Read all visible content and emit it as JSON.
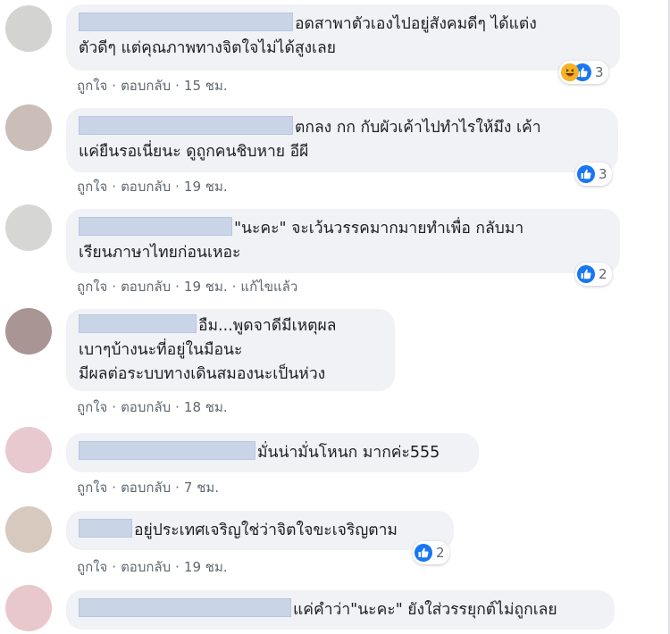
{
  "comments": [
    {
      "lines": [
        "อดสาพาตัวเองไปอยู่สังคมดีๆ ได้แต่ง",
        "ตัวดีๆ แต่คุณภาพทางจิตใจไม่ได้สูงเลย"
      ],
      "actions": {
        "like": "ถูกใจ",
        "reply": "ตอบกลับ",
        "time": "15 ชม."
      },
      "reactions": {
        "icons": [
          "haha-icon",
          "like-icon"
        ],
        "count": "3"
      }
    },
    {
      "lines": [
        "ตกลง กก กับผัวเค้าไปทำไรให้มึง เค้า",
        "แค่ยืนรอเนี่ยนะ ดูถูกคนชิบหาย อีผี"
      ],
      "actions": {
        "like": "ถูกใจ",
        "reply": "ตอบกลับ",
        "time": "19 ชม."
      },
      "reactions": {
        "icons": [
          "like-icon"
        ],
        "count": "3"
      }
    },
    {
      "lines": [
        "\"นะคะ\" จะเว้นวรรคมากมายทำเพื่อ กลับมา",
        "เรียนภาษาไทยก่อนเหอะ"
      ],
      "actions": {
        "like": "ถูกใจ",
        "reply": "ตอบกลับ",
        "time": "19 ชม.",
        "edited": "แก้ไขแล้ว"
      },
      "reactions": {
        "icons": [
          "like-icon"
        ],
        "count": "2"
      }
    },
    {
      "lines": [
        "อืม...พูดจาดีมีเหตุผล",
        "เบาๆบ้างนะที่อยู่ในมือนะ",
        "มีผลต่อระบบทางเดินสมองนะเป็นห่วง"
      ],
      "actions": {
        "like": "ถูกใจ",
        "reply": "ตอบกลับ",
        "time": "18 ชม."
      }
    },
    {
      "lines": [
        "มั่นน่ามั่นโหนก มากค่ะ555"
      ],
      "actions": {
        "like": "ถูกใจ",
        "reply": "ตอบกลับ",
        "time": "7 ชม."
      }
    },
    {
      "lines": [
        "อยู่ประเทศเจริญใช่ว่าจิตใจขะเจริญตาม"
      ],
      "actions": {
        "like": "ถูกใจ",
        "reply": "ตอบกลับ",
        "time": "19 ชม."
      },
      "reactions": {
        "icons": [
          "like-icon"
        ],
        "count": "2"
      }
    },
    {
      "lines": [
        "แค่คำว่า\"นะคะ\" ยังใส่วรรยุกต์ไม่ถูกเลย"
      ]
    }
  ],
  "colors": {
    "bubble": "#f0f2f5",
    "like": "#1877f2",
    "haha": "#f7b125",
    "meta_text": "#606770",
    "redacted_name": "#c9d4e6"
  }
}
